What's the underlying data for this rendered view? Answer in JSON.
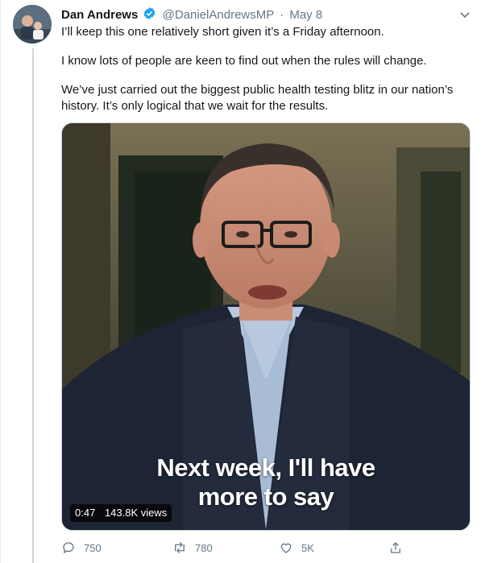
{
  "tweet": {
    "author_name": "Dan Andrews",
    "handle": "@DanielAndrewsMP",
    "separator": "·",
    "date": "May 8",
    "paragraphs": [
      "I’ll keep this one relatively short given it’s a Friday afternoon.",
      "I know lots of people are keen to find out when the rules will change.",
      "We’ve just carried out the biggest public health testing blitz in our nation’s history. It’s only logical that we wait for the results."
    ]
  },
  "video": {
    "caption_line1": "Next week, I'll have",
    "caption_line2": "more to say",
    "duration": "0:47",
    "views": "143.8K views"
  },
  "actions": {
    "replies": "750",
    "retweets": "780",
    "likes": "5K"
  },
  "colors": {
    "verified": "#1da1f2",
    "muted_text": "#657786",
    "primary_text": "#14171a"
  },
  "icons": [
    "verified-badge-icon",
    "caret-down-icon",
    "reply-icon",
    "retweet-icon",
    "like-icon",
    "share-icon"
  ]
}
